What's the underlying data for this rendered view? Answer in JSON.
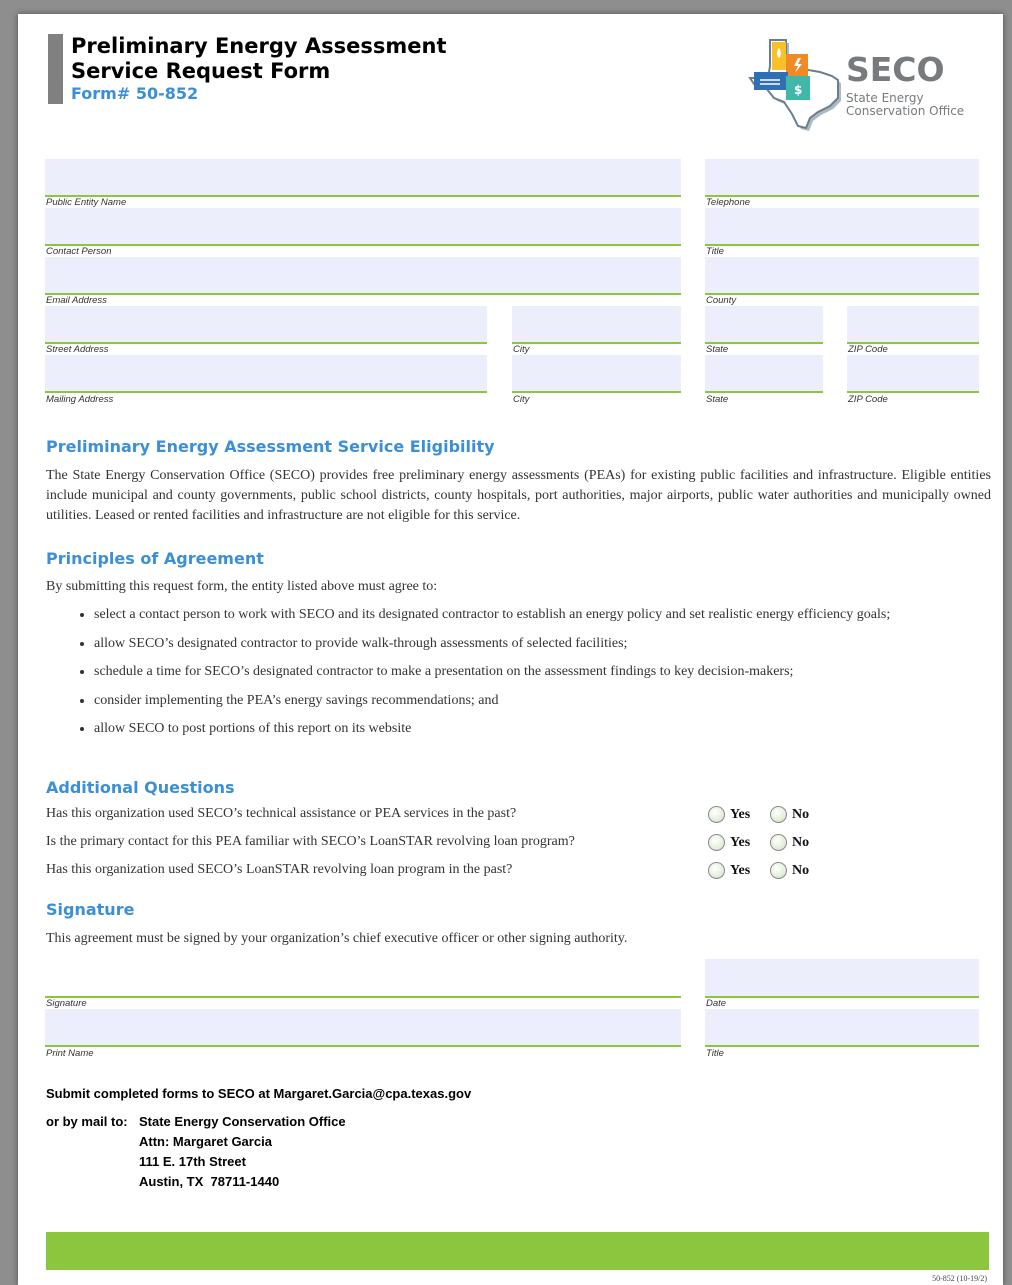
{
  "header": {
    "title_line1": "Preliminary Energy Assessment",
    "title_line2": "Service Request Form",
    "form_number": "Form# 50-852"
  },
  "logo": {
    "name": "SECO",
    "sub_line1": "State Energy",
    "sub_line2": "Conservation Office"
  },
  "fields": {
    "public_entity_name": "Public Entity Name",
    "telephone": "Telephone",
    "contact_person": "Contact Person",
    "title": "Title",
    "email_address": "Email Address",
    "county": "County",
    "street_address": "Street Address",
    "city": "City",
    "state": "State",
    "zip_code": "ZIP Code",
    "mailing_address": "Mailing Address"
  },
  "eligibility": {
    "heading": "Preliminary Energy Assessment Service Eligibility",
    "text": "The State Energy Conservation Office (SECO) provides free preliminary energy assessments (PEAs) for existing public facilities and infrastructure. Eligible entities include municipal and county governments, public school districts, county hospitals, port authorities, major airports, public water authorities and municipally owned utilities. Leased or rented facilities and infrastructure are not eligible for this service."
  },
  "principles": {
    "heading": "Principles of Agreement",
    "intro": "By submitting this request form, the entity listed above must agree to:",
    "items": [
      "select a contact person to work with SECO and its designated contractor to establish an energy policy and set realistic energy efficiency goals;",
      "allow SECO’s designated contractor to provide walk-through assessments of selected facilities;",
      "schedule a time for SECO’s designated contractor to make a presentation on the assessment findings to key decision-makers;",
      "consider implementing the PEA’s energy savings recommendations; and",
      "allow SECO to post portions of this report on its website"
    ]
  },
  "questions": {
    "heading": "Additional Questions",
    "yes_label": "Yes",
    "no_label": "No",
    "items": [
      "Has this organization used SECO’s technical assistance or PEA services in the past?",
      "Is the primary contact for this PEA familiar with SECO’s LoanSTAR revolving loan program?",
      "Has this organization used SECO’s LoanSTAR revolving loan program in the past?"
    ]
  },
  "signature": {
    "heading": "Signature",
    "text": "This agreement must be signed by your organization’s chief executive officer or other signing authority.",
    "signature_label": "Signature",
    "date_label": "Date",
    "print_name_label": "Print Name",
    "title_label": "Title"
  },
  "submit": {
    "line1": "Submit completed forms to SECO at Margaret.Garcia@cpa.texas.gov",
    "mail_prefix": "or by mail to:",
    "address": [
      "State Energy Conservation Office",
      "Attn: Margaret Garcia",
      "111 E. 17th Street",
      "Austin, TX  78711-1440"
    ]
  },
  "footer": {
    "code": "50-852 (10-19/2)"
  },
  "colors": {
    "accent_blue": "#3b8fd6",
    "field_fill": "#eceffb",
    "field_rule": "#8cc63f",
    "band_green": "#8cc63f"
  }
}
